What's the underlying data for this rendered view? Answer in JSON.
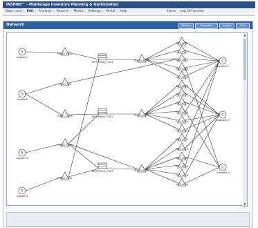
{
  "app": {
    "title": "INSPIRE™ - Multistage Inventory Planning & Optimization"
  },
  "menu": {
    "items": [
      "Data Load",
      "Edit",
      "Analysis",
      "Reports",
      "Media",
      "Settings",
      "Portal",
      "Help"
    ],
    "active": "Edit",
    "user_items": [
      "Home",
      "Log Off system"
    ]
  },
  "panel": {
    "title": "Network",
    "buttons": [
      "Refresh",
      "Properties",
      "Export",
      "Print"
    ]
  },
  "nodes": {
    "suppliers": [
      "Supplier1",
      "Supplier2",
      "Supplier 3",
      "Supplier4"
    ],
    "plants": [
      "Plant1_FG01",
      "Plant1_C02",
      "Plant1_Comp",
      "Plant1_FG03",
      "Plant2_FG02"
    ],
    "warehouses": [
      "RMT_Plant1_FG01",
      "RMT_Plant2_FG02",
      "RMT_Plant2_FG03"
    ],
    "plant_fg": [
      "Plant2_FG01",
      "Plant1_FG04",
      "Plant2_FG03"
    ],
    "dcs": [
      "DC1_FG01",
      "DC2_FG01",
      "DC3_FG01",
      "DC1_FG02",
      "DC2_FG02",
      "DC3_FG02",
      "DC1_FG03",
      "DC2_FG03",
      "DC3_FG03",
      "DC1_FG04",
      "DC2_FG04",
      "DC1_FG05",
      "DC2_FG05",
      "DC3_FG05",
      "DC1_FG06",
      "DC2_FG06",
      "DC3_FG06"
    ],
    "customers": [
      "Customer 1",
      "Customer 2",
      "Customer 3"
    ]
  },
  "colors": {
    "header": "#2d5fa5",
    "titlebar": "#2d4f88",
    "node_stroke": "#333333",
    "edge": "#333333"
  }
}
